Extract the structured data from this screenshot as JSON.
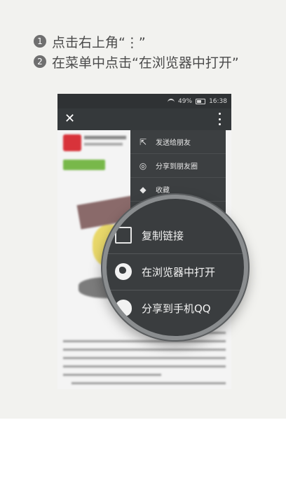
{
  "instructions": {
    "step1": {
      "number": "1",
      "text": "点击右上角“⋮”"
    },
    "step2": {
      "number": "2",
      "text": "在菜单中点击“在浏览器中打开”"
    }
  },
  "status_bar": {
    "battery": "49%",
    "time": "16:38"
  },
  "menu": {
    "items": [
      {
        "label": "发送给朋友",
        "icon": "share-icon"
      },
      {
        "label": "分享到朋友圈",
        "icon": "moments-icon"
      },
      {
        "label": "收藏",
        "icon": "cube-icon"
      }
    ]
  },
  "magnifier": {
    "items": [
      {
        "label": "复制链接",
        "icon": "document-icon"
      },
      {
        "label": "在浏览器中打开",
        "icon": "globe-icon"
      },
      {
        "label": "分享到手机QQ",
        "icon": "qq-icon"
      }
    ]
  },
  "colors": {
    "background": "#f2f2ef",
    "menu": "#3c3f41",
    "titlebar": "#35393b"
  }
}
